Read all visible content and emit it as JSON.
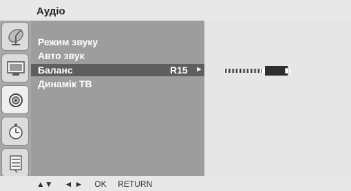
{
  "header": {
    "title": "Аудіо"
  },
  "sidebar": {
    "icons": [
      {
        "name": "satellite-dish-icon"
      },
      {
        "name": "picture-monitor-icon"
      },
      {
        "name": "audio-speaker-icon"
      },
      {
        "name": "time-clock-icon"
      },
      {
        "name": "setup-option-icon"
      }
    ],
    "active_index": 2
  },
  "menu": {
    "items": [
      {
        "label": "Режим звуку"
      },
      {
        "label": "Авто звук"
      },
      {
        "label": "Баланс",
        "value": "R15",
        "arrow": "►"
      },
      {
        "label": "Динамік ТВ"
      }
    ],
    "selected_index": 2
  },
  "balance": {
    "value_label": "R15",
    "level_fraction": 0.67
  },
  "footer": {
    "updown_glyph": "▲▼",
    "leftright_glyph": "◄ ►",
    "ok_label": "OK",
    "return_label": "RETURN"
  }
}
